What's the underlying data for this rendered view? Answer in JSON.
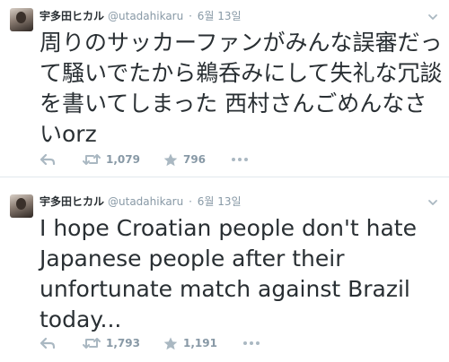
{
  "tweets": [
    {
      "name": "宇多田ヒカル",
      "handle": "@utadahikaru",
      "separator": "·",
      "date": "6월 13일",
      "text": "周りのサッカーファンがみんな誤審だって騒いでたから鵜呑みにして失礼な冗談を書いてしまった 西村さんごめんなさいorz",
      "retweets": "1,079",
      "favorites": "796"
    },
    {
      "name": "宇多田ヒカル",
      "handle": "@utadahikaru",
      "separator": "·",
      "date": "6월 13일",
      "text": "I hope Croatian people don't hate Japanese people after their unfortunate match against Brazil today...",
      "retweets": "1,793",
      "favorites": "1,191"
    }
  ],
  "icons": {
    "reply": "reply-icon",
    "retweet": "retweet-icon",
    "favorite": "star-icon",
    "more": "more-dots-icon",
    "menu": "chevron-down-icon"
  },
  "colors": {
    "text": "#292f33",
    "muted": "#8899a6",
    "icon": "#aab8c2",
    "divider": "#e1e8ed"
  }
}
